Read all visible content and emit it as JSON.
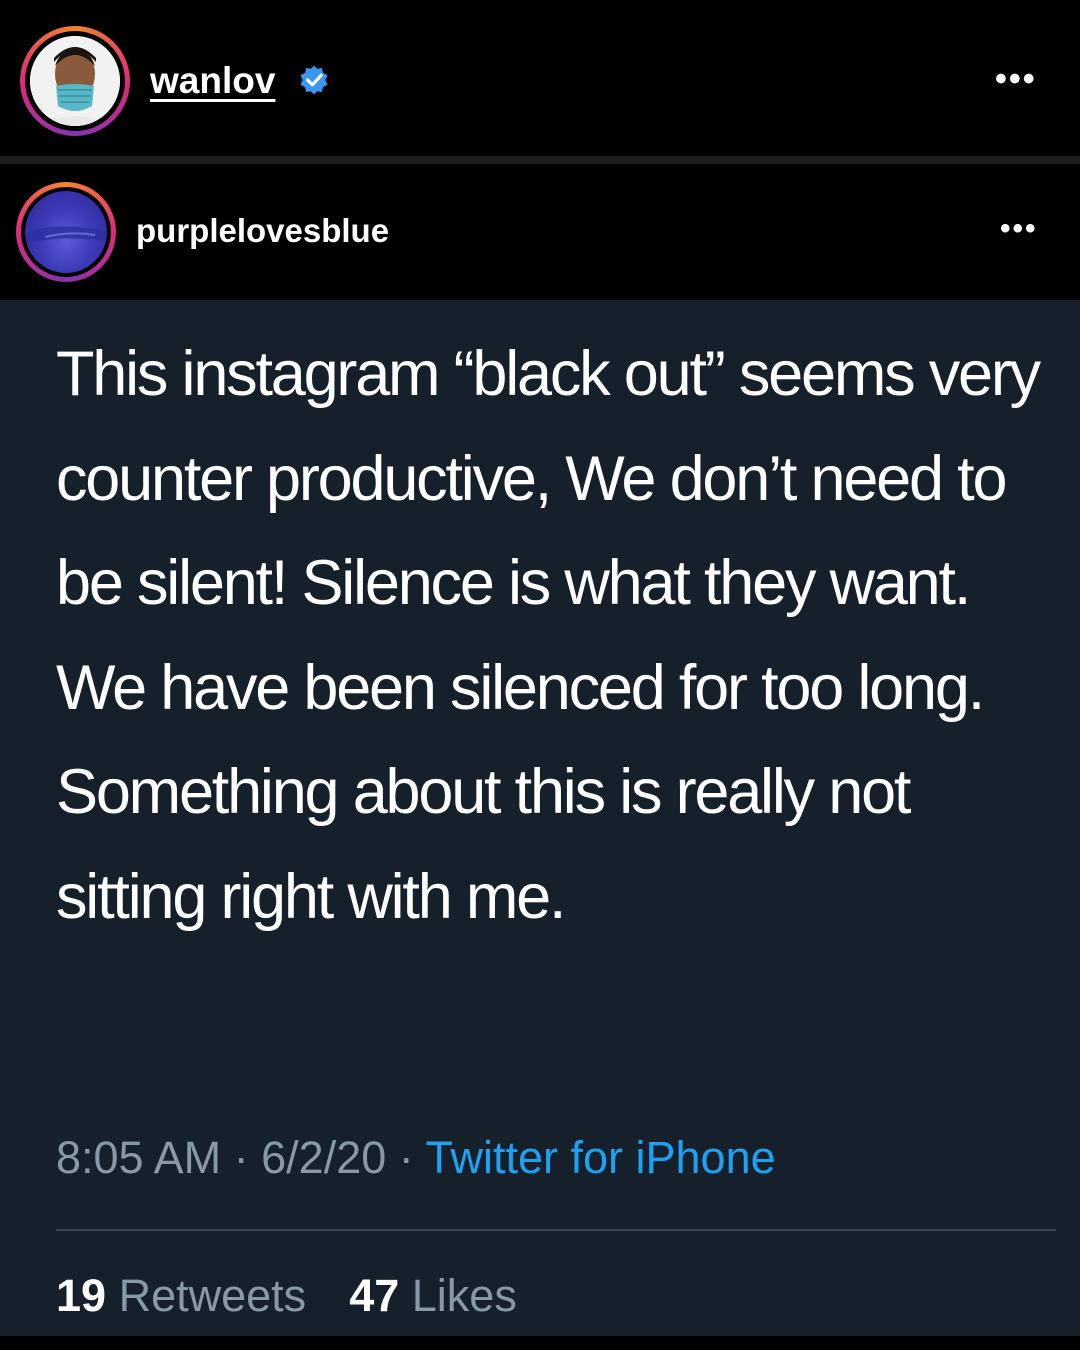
{
  "post": {
    "username": "wanlov",
    "verified": true,
    "more_icon": "•••"
  },
  "repost": {
    "username": "purplelovesblue",
    "more_icon": "•••"
  },
  "tweet": {
    "text": "This instagram “black out” seems very counter productive, We don’t need to be silent! Silence is what they want. We have been silenced for too long. Something about this is really not sitting right with me.",
    "time": "8:05 AM",
    "separator": "·",
    "date": "6/2/20",
    "source": "Twitter for iPhone",
    "retweets_count": "19",
    "retweets_label": "Retweets",
    "likes_count": "47",
    "likes_label": "Likes"
  },
  "colors": {
    "tweet_background": "#15202b",
    "link": "#1da1f2",
    "muted_text": "#8899a6",
    "verified_badge": "#3897f0"
  }
}
